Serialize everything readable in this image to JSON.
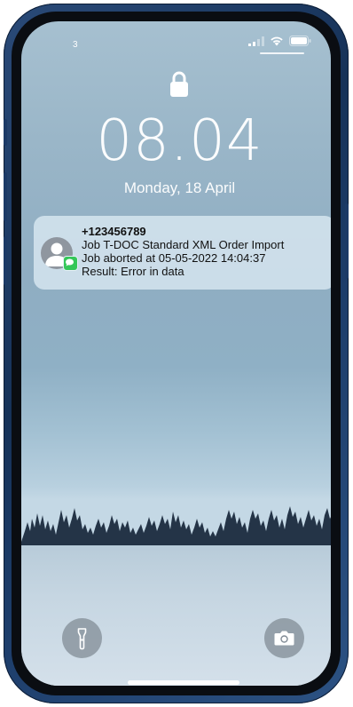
{
  "status_bar": {
    "left_text": "3",
    "icons": [
      "signal-icon",
      "wifi-icon",
      "battery-icon"
    ]
  },
  "lock_screen": {
    "lock_icon": "lock-icon",
    "time": "08.04",
    "date": "Monday, 18 April"
  },
  "notification": {
    "sender": "+123456789",
    "lines": [
      "Job T-DOC Standard XML Order Import",
      "Job aborted at 05-05-2022 14:04:37",
      "Result: Error in data"
    ],
    "app_icon": "messages-icon",
    "avatar_icon": "contact-avatar-icon"
  },
  "quick_actions": {
    "left_icon": "flashlight-icon",
    "right_icon": "camera-icon"
  },
  "colors": {
    "phone_frame": "#1d3d6a",
    "messages_green": "#35c759"
  }
}
